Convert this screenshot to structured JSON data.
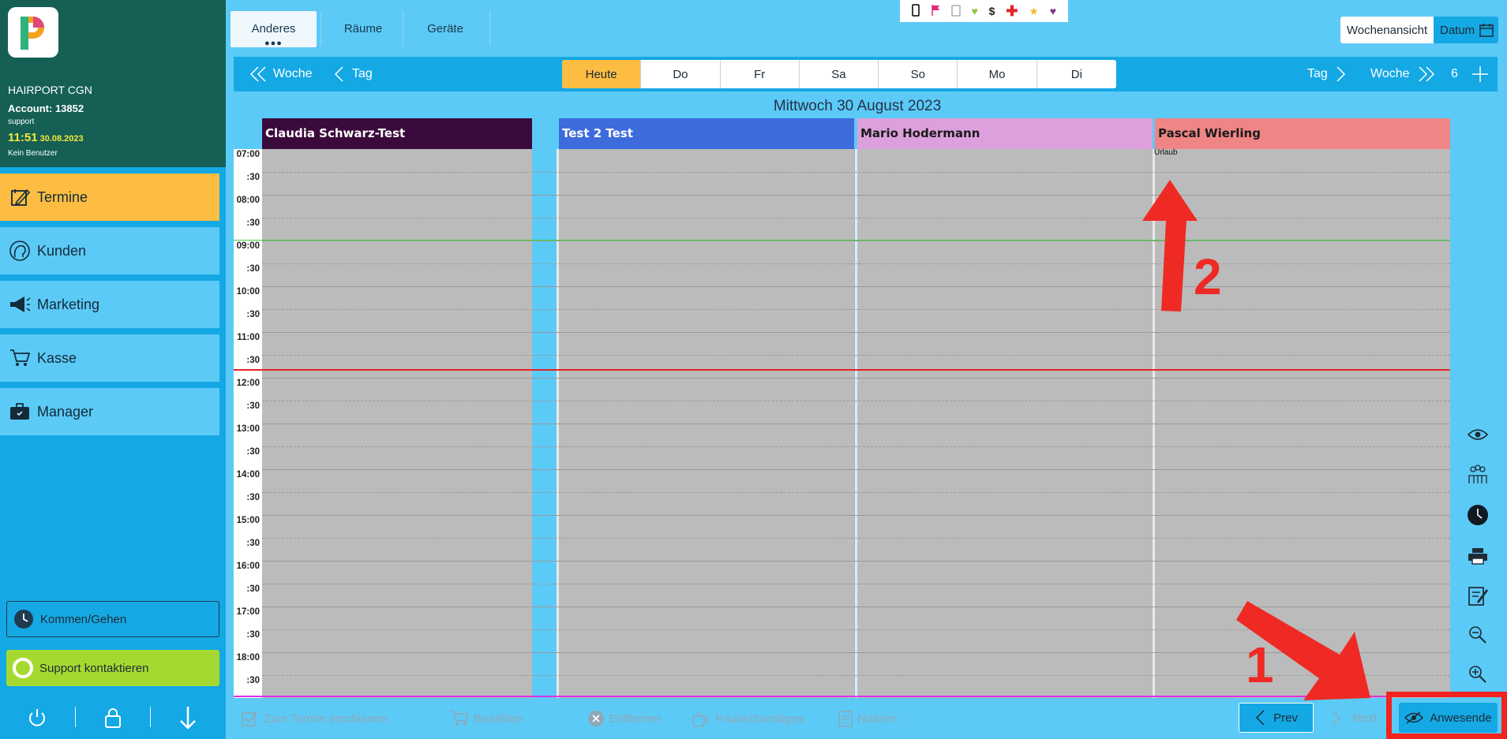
{
  "sidebar": {
    "salon": "HAIRPORT CGN",
    "account": "Account: 13852",
    "role": "support",
    "time": "11:51",
    "date": "30.08.2023",
    "user": "Kein Benutzer",
    "nav": [
      {
        "label": "Termine",
        "icon": "calendar-edit-icon"
      },
      {
        "label": "Kunden",
        "icon": "customer-head-icon"
      },
      {
        "label": "Marketing",
        "icon": "megaphone-icon"
      },
      {
        "label": "Kasse",
        "icon": "cart-icon"
      },
      {
        "label": "Manager",
        "icon": "briefcase-icon"
      }
    ],
    "kommen_label": "Kommen/Gehen",
    "support_label": "Support kontaktieren"
  },
  "tabs": [
    "Anderes",
    "Räume",
    "Geräte"
  ],
  "header": {
    "week_view": "Wochenansicht",
    "date_button": "Datum"
  },
  "navbar": {
    "prev_week": "Woche",
    "prev_day": "Tag",
    "days": [
      "Heute",
      "Do",
      "Fr",
      "Sa",
      "So",
      "Mo",
      "Di"
    ],
    "next_day": "Tag",
    "next_week": "Woche",
    "count": "6"
  },
  "date_title": "Mittwoch 30 August 2023",
  "staff": [
    {
      "name": "Claudia Schwarz-Test",
      "color": "#3b0a3c",
      "text": "#ffffff"
    },
    {
      "name": "Test 2 Test",
      "color": "#3d6bdc",
      "text": "#ffffff"
    },
    {
      "name": "Mario Hodermann",
      "color": "#dca0dc",
      "text": "#1a1a1a"
    },
    {
      "name": "Pascal Wierling",
      "color": "#f08585",
      "text": "#1a1a1a"
    }
  ],
  "absence_label": "Urlaub",
  "times": [
    "07:00",
    ":30",
    "08:00",
    ":30",
    "09:00",
    ":30",
    "10:00",
    ":30",
    "11:00",
    ":30",
    "12:00",
    ":30",
    "13:00",
    ":30",
    "14:00",
    ":30",
    "15:00",
    ":30",
    "16:00",
    ":30",
    "17:00",
    ":30",
    "18:00",
    ":30"
  ],
  "bottom": {
    "erschienen": "Zum Termin erschienen",
    "bezahlen": "Bezahlen",
    "entfernen": "Entfernen",
    "pause": "Pause/Sonstiges",
    "notizen": "Notizen",
    "prev": "Prev",
    "next": "Next",
    "anwesende": "Anwesende"
  },
  "annotations": [
    "1",
    "2"
  ],
  "colors": {
    "sidebar_dark": "#155f55",
    "accent_orange": "#fdbd42",
    "accent_blue": "#14a8e4",
    "light_blue": "#5ccaf6",
    "annotation_red": "#f2221f"
  }
}
